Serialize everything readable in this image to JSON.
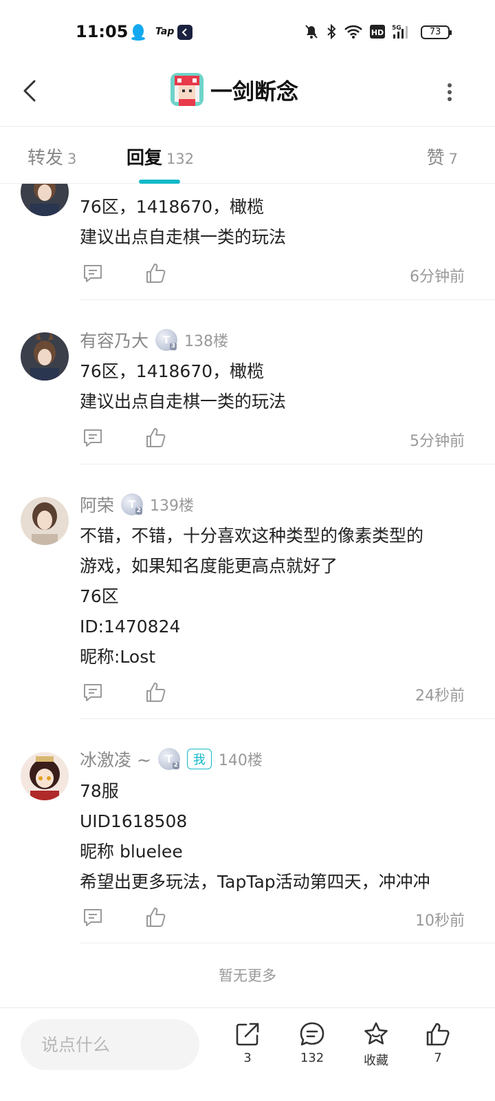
{
  "status_bar": {
    "time": "11:05",
    "tap_label": "Tap",
    "battery": "73"
  },
  "header": {
    "title": "一剑断念"
  },
  "tabs": [
    {
      "label": "转发",
      "count": "3"
    },
    {
      "label": "回复",
      "count": "132"
    },
    {
      "label": "赞",
      "count": "7"
    }
  ],
  "comments": [
    {
      "username": "",
      "floor": "",
      "lines": [
        "76区，1418670，橄榄",
        "建议出点自走棋一类的玩法"
      ],
      "time": "6分钟前"
    },
    {
      "username": "有容乃大",
      "floor": "138楼",
      "lines": [
        "76区，1418670，橄榄",
        "建议出点自走棋一类的玩法"
      ],
      "time": "5分钟前"
    },
    {
      "username": "阿荣",
      "floor": "139楼",
      "lines": [
        "不错，不错，十分喜欢这种类型的像素类型的",
        "游戏，如果知名度能更高点就好了",
        "76区",
        "ID:1470824",
        "昵称:Lost"
      ],
      "time": "24秒前"
    },
    {
      "username": "冰激凌 ~",
      "me_badge": "我",
      "floor": "140楼",
      "lines": [
        "78服",
        "UID1618508",
        "昵称 bluelee",
        "希望出更多玩法，TapTap活动第四天，冲冲冲"
      ],
      "time": "10秒前"
    }
  ],
  "no_more": "暂无更多",
  "bottom_bar": {
    "input_placeholder": "说点什么",
    "share_count": "3",
    "comment_count": "132",
    "favorite_label": "收藏",
    "like_count": "7"
  }
}
